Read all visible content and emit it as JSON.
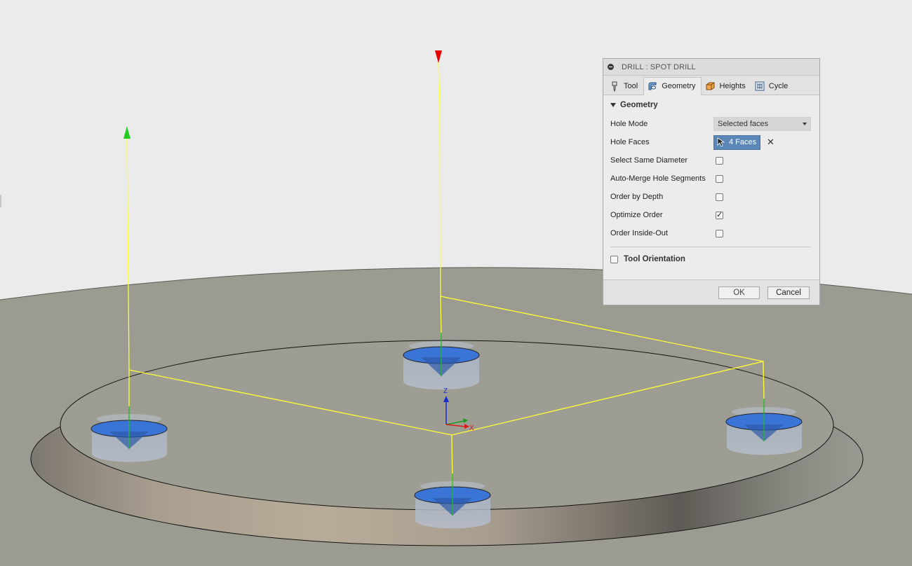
{
  "viewport": {
    "axis_z_label": "Z",
    "axis_x_label": "X",
    "colors": {
      "background": "#ebebeb",
      "stock": "#9a9a90",
      "toolpath": "#ffff33",
      "hole": "#3f78d8",
      "arrow_red": "#e60000",
      "arrow_green": "#22cc22"
    }
  },
  "dialog": {
    "title": "DRILL : SPOT DRILL",
    "tabs": [
      {
        "label": "Tool",
        "icon": "tool-icon"
      },
      {
        "label": "Geometry",
        "icon": "geometry-icon"
      },
      {
        "label": "Heights",
        "icon": "heights-icon"
      },
      {
        "label": "Cycle",
        "icon": "cycle-icon"
      }
    ],
    "active_tab": "Geometry",
    "group_title": "Geometry",
    "hole_mode": {
      "label": "Hole Mode",
      "value": "Selected faces"
    },
    "hole_faces": {
      "label": "Hole Faces",
      "value": "4 Faces"
    },
    "options": [
      {
        "label": "Select Same Diameter",
        "checked": false
      },
      {
        "label": "Auto-Merge Hole Segments",
        "checked": false
      },
      {
        "label": "Order by Depth",
        "checked": false
      },
      {
        "label": "Optimize Order",
        "checked": true
      },
      {
        "label": "Order Inside-Out",
        "checked": false
      }
    ],
    "tool_orientation": {
      "label": "Tool Orientation",
      "checked": false
    },
    "ok_label": "OK",
    "cancel_label": "Cancel"
  }
}
